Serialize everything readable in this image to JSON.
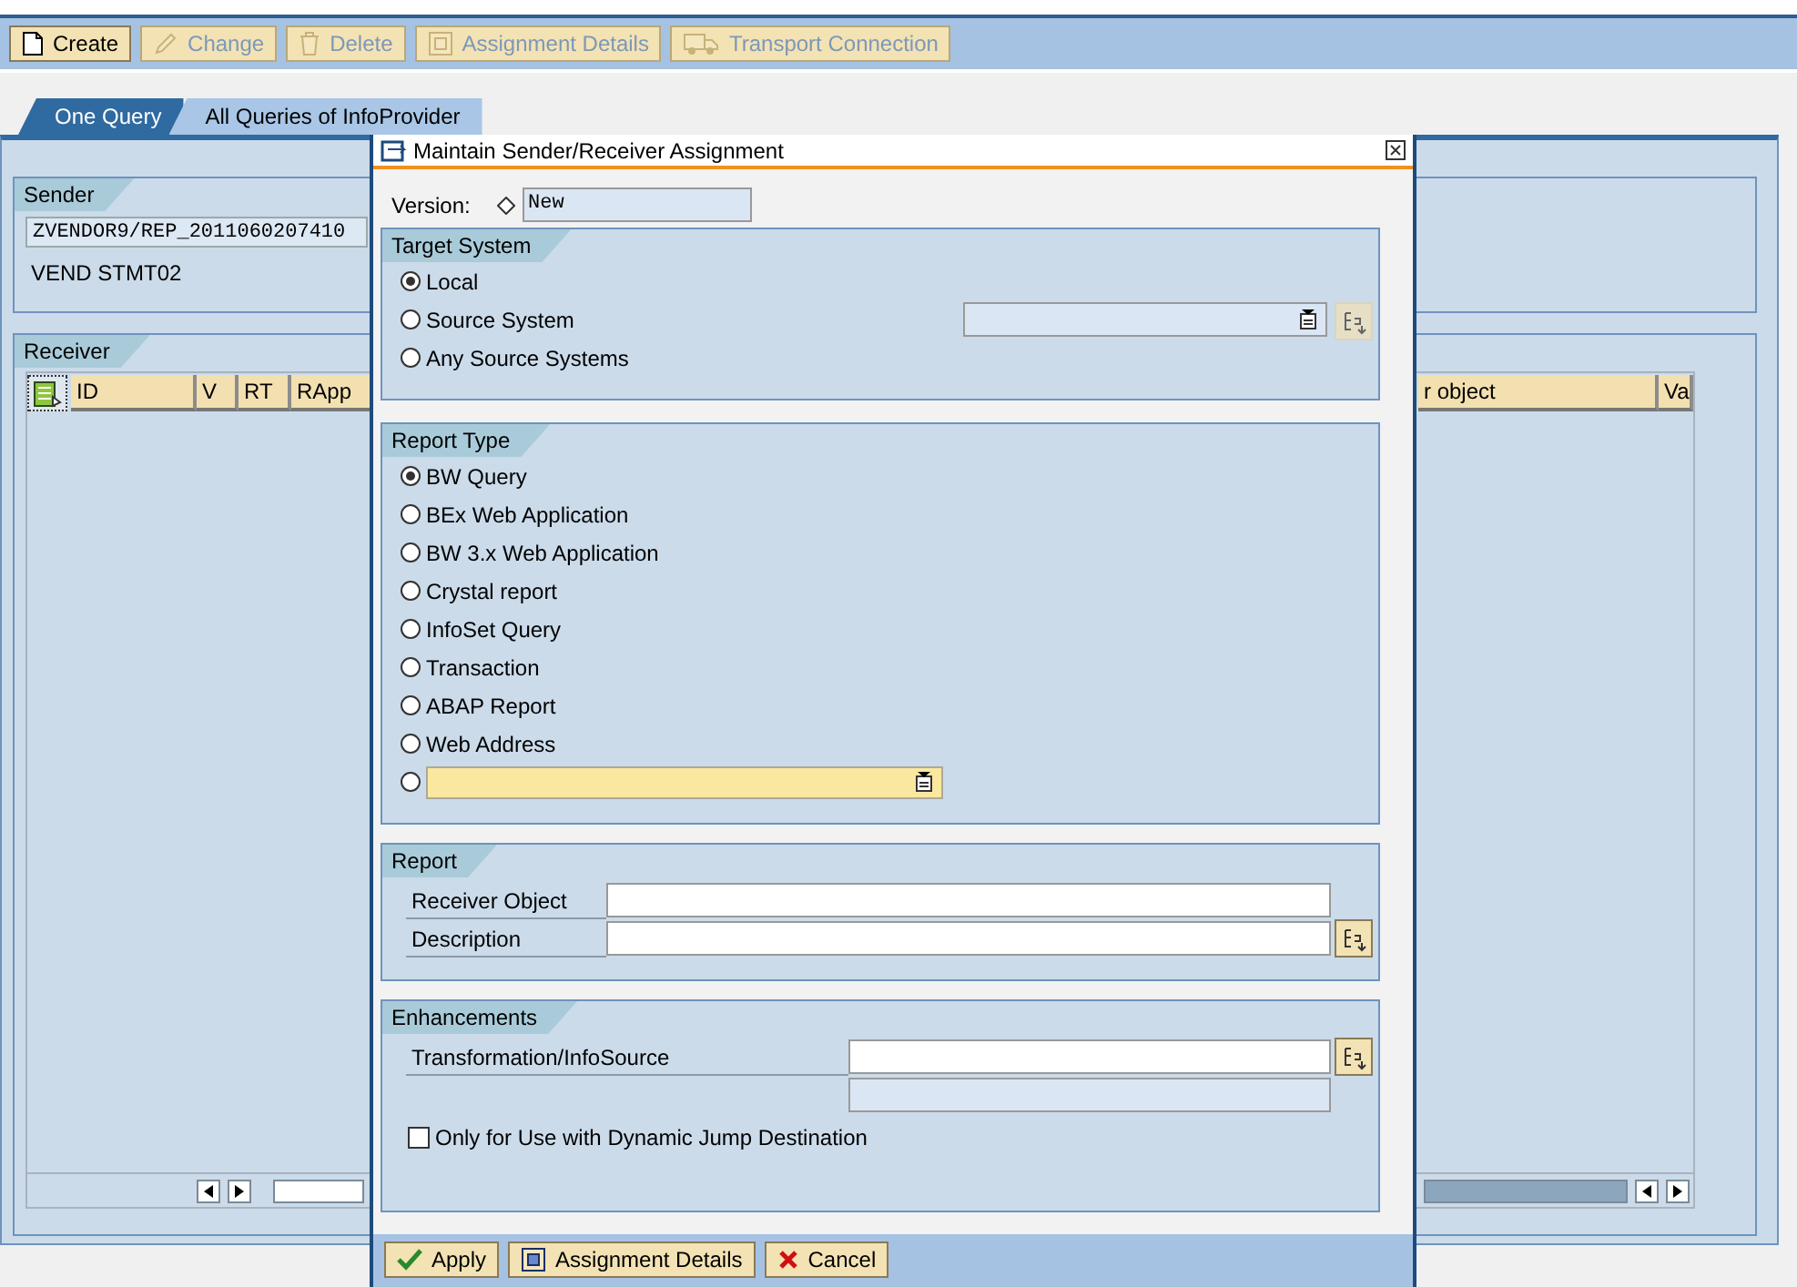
{
  "toolbar": {
    "buttons": [
      {
        "label": "Create",
        "kind": "create",
        "disabled": false
      },
      {
        "label": "Change",
        "kind": "change",
        "disabled": true
      },
      {
        "label": "Delete",
        "kind": "delete",
        "disabled": true
      },
      {
        "label": "Assignment Details",
        "kind": "details",
        "disabled": true
      },
      {
        "label": "Transport Connection",
        "kind": "transport",
        "disabled": true
      }
    ]
  },
  "tabs": [
    {
      "label": "One Query",
      "selected": true
    },
    {
      "label": "All Queries of InfoProvider",
      "selected": false
    }
  ],
  "sender": {
    "title": "Sender",
    "query": "ZVENDOR9/REP_2011060207410",
    "description": "VEND STMT02"
  },
  "receiver": {
    "title": "Receiver",
    "columns": [
      "ID",
      "V",
      "RT",
      "RApp"
    ],
    "cut_columns": [
      "r object",
      "Va"
    ]
  },
  "dialog": {
    "title": "Maintain Sender/Receiver Assignment",
    "version": {
      "label": "Version:",
      "value": "New"
    },
    "target_system": {
      "title": "Target System",
      "options": [
        {
          "label": "Local",
          "selected": true
        },
        {
          "label": "Source System",
          "selected": false
        },
        {
          "label": "Any Source Systems",
          "selected": false
        }
      ]
    },
    "report_type": {
      "title": "Report Type",
      "options": [
        {
          "kind": "label",
          "label": "BW Query",
          "selected": true
        },
        {
          "kind": "label",
          "label": "BEx Web Application",
          "selected": false
        },
        {
          "kind": "label",
          "label": "BW 3.x Web Application",
          "selected": false
        },
        {
          "kind": "label",
          "label": "Crystal report",
          "selected": false
        },
        {
          "kind": "label",
          "label": "InfoSet Query",
          "selected": false
        },
        {
          "kind": "label",
          "label": "Transaction",
          "selected": false
        },
        {
          "kind": "label",
          "label": "ABAP Report",
          "selected": false
        },
        {
          "kind": "label",
          "label": "Web Address",
          "selected": false
        },
        {
          "kind": "field",
          "selected": false
        }
      ]
    },
    "report": {
      "title": "Report",
      "fields": [
        {
          "label": "Receiver Object",
          "help": false
        },
        {
          "label": "Description",
          "help": true
        }
      ]
    },
    "enhancements": {
      "title": "Enhancements",
      "fields": [
        {
          "label": "Transformation/InfoSource",
          "help": true
        }
      ],
      "checkbox": {
        "label": "Only for Use with Dynamic Jump Destination",
        "checked": false
      }
    },
    "buttons": [
      {
        "label": "Apply",
        "kind": "apply"
      },
      {
        "label": "Assignment Details",
        "kind": "details"
      },
      {
        "label": "Cancel",
        "kind": "cancel"
      }
    ]
  }
}
